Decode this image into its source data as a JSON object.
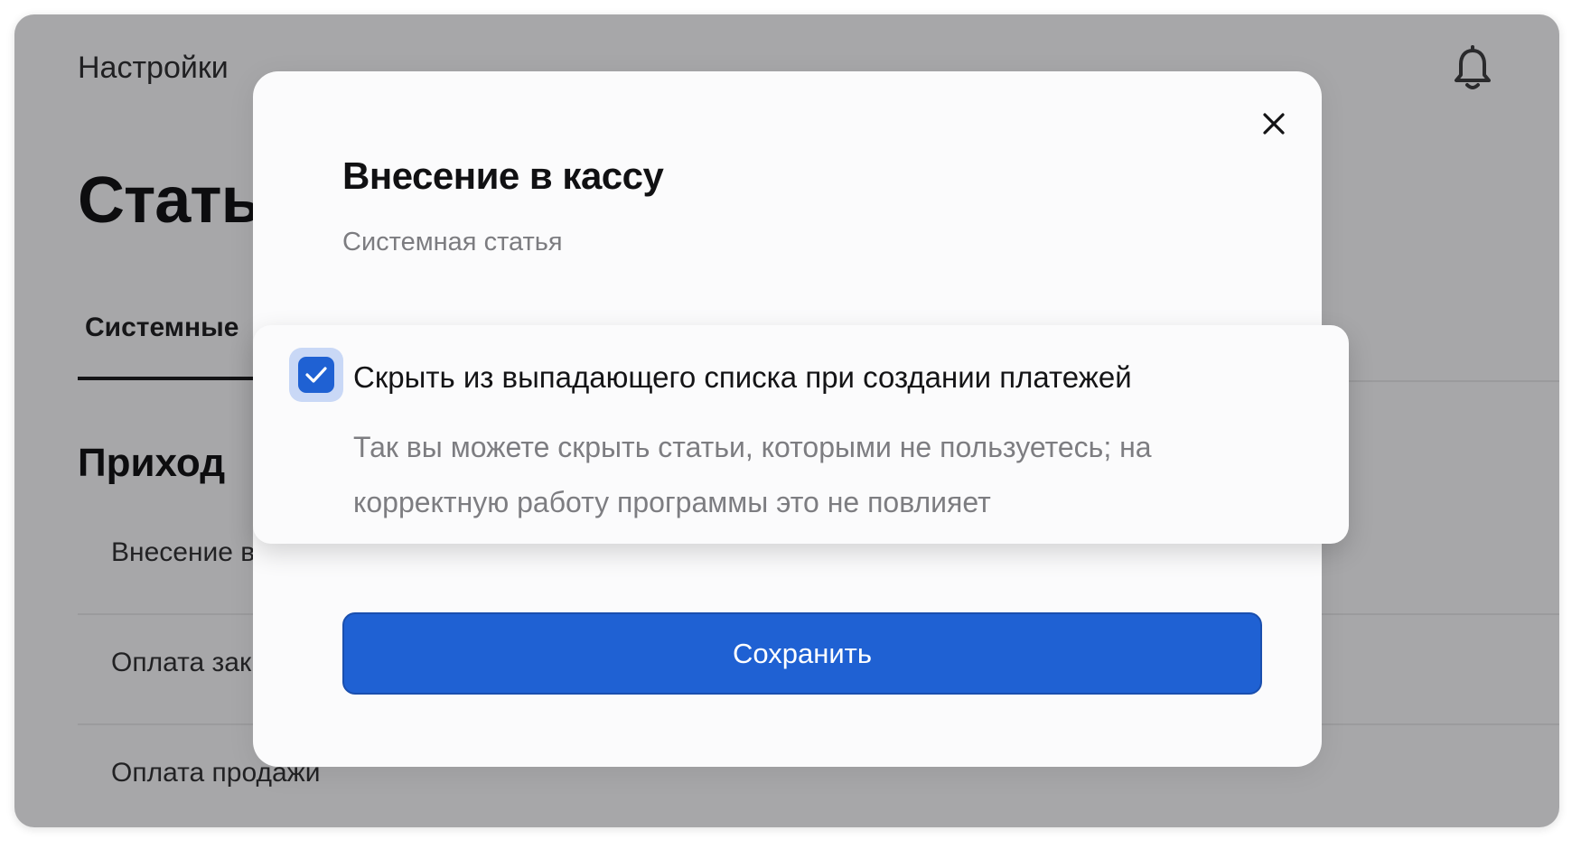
{
  "header": {
    "title": "Настройки",
    "bell_icon": "bell-icon"
  },
  "page": {
    "title": "Стать",
    "tabs": [
      {
        "label": "Системные",
        "active": true
      }
    ],
    "section_title": "Приход",
    "items": [
      {
        "label": "Внесение в"
      },
      {
        "label": "Оплата зак"
      },
      {
        "label": "Оплата продажи"
      }
    ]
  },
  "modal": {
    "title": "Внесение в кассу",
    "subtitle": "Системная статья",
    "close_icon": "close-icon",
    "checkbox": {
      "checked": true,
      "label": "Скрыть из выпадающего списка при создании платежей",
      "description": "Так вы можете скрыть статьи, которыми не пользуетесь; на корректную работу программы это не повлияет"
    },
    "save_label": "Сохранить"
  },
  "colors": {
    "accent": "#1f61d3",
    "overlay": "#a7a7a9",
    "modal_bg": "#fbfbfc",
    "muted_text": "#7d7d81"
  }
}
